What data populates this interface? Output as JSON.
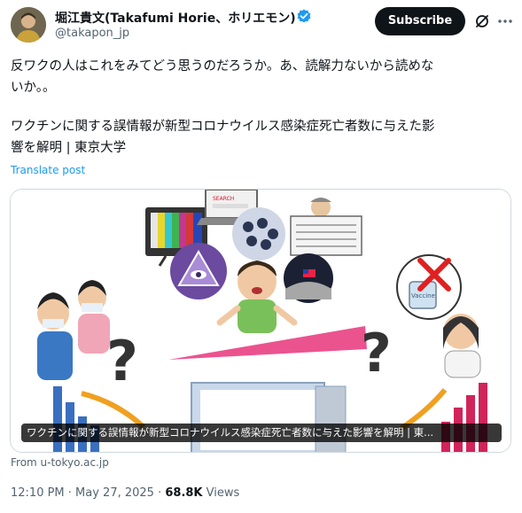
{
  "author": {
    "name": "堀江貴文(Takafumi Horie、ホリエモン)",
    "handle": "@takapon_jp",
    "verified_color": "#1d9bf0"
  },
  "header": {
    "subscribe_label": "Subscribe",
    "grok_icon": "grok-icon",
    "more_icon": "more-icon"
  },
  "post": {
    "line1": "反ワクの人はこれをみてどう思うのだろうか。あ、読解力ないから読めな",
    "line2": "いか。。",
    "line3": "ワクチンに関する誤情報が新型コロナウイルス感染症死亡者数に与えた影",
    "line4": "響を解明 | 東京大学",
    "translate_label": "Translate post"
  },
  "card": {
    "caption": "ワクチンに関する誤情報が新型コロナウイルス感染症死亡者数に与えた影響を解明 | 東...",
    "source": "From u-tokyo.ac.jp",
    "illustration_texts": {
      "search": "SEARCH",
      "vaccine": "Vaccine"
    }
  },
  "meta": {
    "time": "12:10 PM · May 27, 2025 · ",
    "views_count": "68.8K",
    "views_label": " Views"
  },
  "colors": {
    "text": "#0f1419",
    "secondary": "#536471",
    "link": "#1d9bf0",
    "subscribe_bg": "#0f1419",
    "border": "#cfd9de"
  }
}
